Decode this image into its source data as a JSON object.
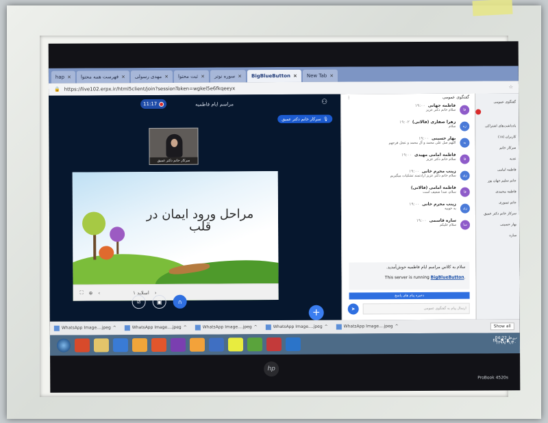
{
  "browser": {
    "tabs": [
      {
        "label": "hap"
      },
      {
        "label": "فهرست همه محتوا"
      },
      {
        "label": "مهدی رسولی"
      },
      {
        "label": "ثبت محتوا"
      },
      {
        "label": "سوره نوتر"
      },
      {
        "label": "BigBlueButton"
      },
      {
        "label": "New Tab"
      }
    ],
    "url": "https://live102.erpx.ir/html5client/join?sessionToken=wgkel5e6fkqeeyx"
  },
  "meeting": {
    "title": "مراسم ایام فاطمیه",
    "timer": "11:17",
    "presenter": "سرکار خانم دکتر عمیق",
    "webcam_name": "سرکار خانم دکتر عمیق"
  },
  "slide": {
    "title": "مراحل ورود ایمان در قلب",
    "page": "اسلاید ۱"
  },
  "chat": {
    "header": "گفتگوی عمومی",
    "messages": [
      {
        "initials": "فا",
        "name": "فاطمه جهانی",
        "time": "۱۹:۰۰",
        "text": "سلام خانم دکتر عزیز",
        "color": "#8e5bc9"
      },
      {
        "initials": "زه",
        "name": "زهرا صفاری (فالاتی)",
        "time": "۱۹:۰۲",
        "text": "سلام",
        "color": "#4a7ad8"
      },
      {
        "initials": "به",
        "name": "بهار حسینی",
        "time": "۱۹:۰۰",
        "text": "اللهم صل علی محمد و آل محمد و عجل فرجهم",
        "color": "#4a7ad8"
      },
      {
        "initials": "فا",
        "name": "فاطمه امامی مهیدی",
        "time": "۱۹:۰۰",
        "text": "سلام خانم دکتر عزیز",
        "color": "#8e5bc9"
      },
      {
        "initials": "زی",
        "name": "زینب محرم خانی",
        "time": "۱۹:۰۰",
        "text": "سلام خانم دکتر عزیز ارادتمند تشکیات میگیریم",
        "color": "#4a7ad8"
      },
      {
        "initials": "فا",
        "name": "فاطمه امامی (فالاتی)",
        "time": "",
        "text": "سلام، صدا ضعیف است",
        "color": "#8e5bc9"
      },
      {
        "initials": "زی",
        "name": "زینب محرم خانی",
        "time": "۱۹:۰۰",
        "text": "به خوبیه",
        "color": "#4a7ad8"
      },
      {
        "initials": "سا",
        "name": "ساره قاسمی",
        "time": "۱۹:۰۰",
        "text": "سلام علیکم",
        "color": "#8e5bc9"
      }
    ],
    "welcome_line1": "سلام به کلاس مراسم ایام فاطمیه خوش‌آمدید.",
    "welcome_line2_prefix": "This server is running ",
    "welcome_line2_link": "BigBlueButton",
    "welcome_line2_suffix": ".",
    "bar_label": "ذخیره پیام های پاسخ",
    "input_placeholder": "ارسال پیام به گفتگوی عمومی"
  },
  "users": {
    "items": [
      "گفتگوی عمومی",
      "یادداشت‌های اشتراکی",
      "کاربران (۱۸)",
      "سرکار خانم",
      "عدیه",
      "فاطمه امامی",
      "جانم سلیم جهان پور",
      "فاطمه محمدی",
      "جانم تیموری",
      "سرکار خانم دکتر عمیق",
      "بهار حسینی",
      "ساره"
    ]
  },
  "downloads": {
    "items": [
      "WhatsApp Image....jpeg",
      "WhatsApp Image....jpeg",
      "WhatsApp Image....jpeg",
      "WhatsApp Image....jpeg",
      "WhatsApp Image....jpeg"
    ],
    "show_all": "Show all"
  },
  "taskbar": {
    "lang": "FA",
    "time": "04:22 ب.ظ",
    "date": "۱۳۹۹/۰۱/۲۰"
  },
  "bezel": {
    "logo": "hp",
    "model": "ProBook 4520s"
  },
  "icons": {
    "send": "send-icon",
    "plus": "plus-icon",
    "users": "users-icon",
    "mic": "headphones-icon",
    "video": "video-icon",
    "screen": "screen-share-icon"
  }
}
